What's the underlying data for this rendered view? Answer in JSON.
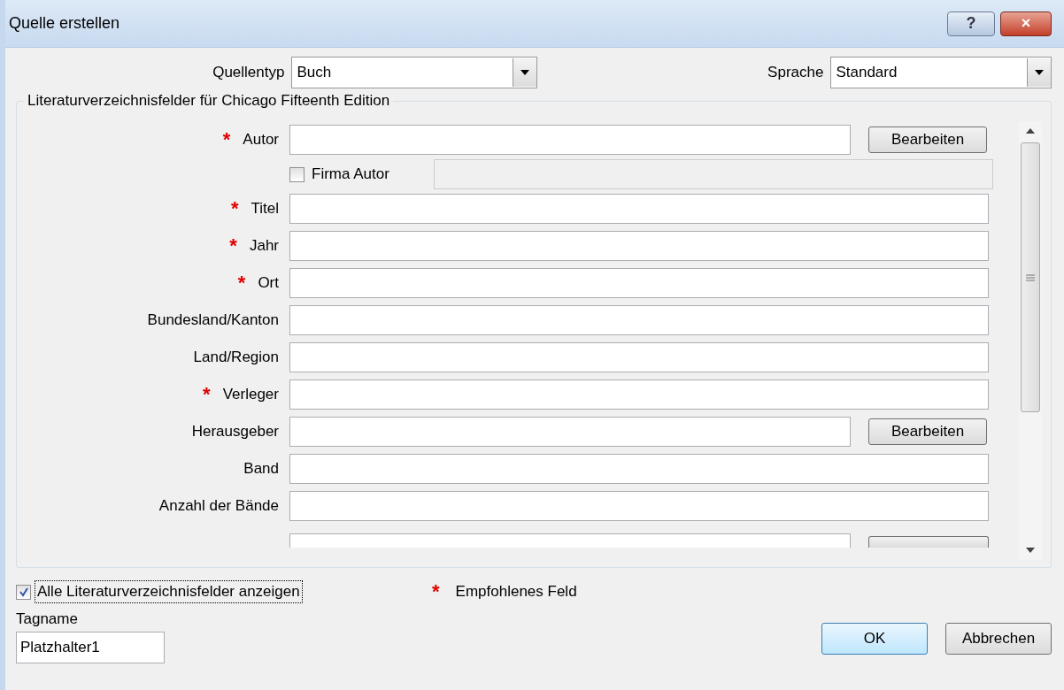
{
  "window": {
    "title": "Quelle erstellen",
    "help": "?",
    "close": "×"
  },
  "source_type": {
    "label": "Quellentyp",
    "value": "Buch"
  },
  "language": {
    "label": "Sprache",
    "value": "Standard"
  },
  "group": {
    "title": "Literaturverzeichnisfelder für Chicago Fifteenth Edition",
    "rows": [
      {
        "kind": "field",
        "label": "Autor",
        "required": true,
        "button": "Bearbeiten"
      },
      {
        "kind": "checkbox",
        "label": "Firma Autor",
        "checked": false
      },
      {
        "kind": "field",
        "label": "Titel",
        "required": true
      },
      {
        "kind": "field",
        "label": "Jahr",
        "required": true
      },
      {
        "kind": "field",
        "label": "Ort",
        "required": true
      },
      {
        "kind": "field",
        "label": "Bundesland/Kanton",
        "required": false
      },
      {
        "kind": "field",
        "label": "Land/Region",
        "required": false
      },
      {
        "kind": "field",
        "label": "Verleger",
        "required": true
      },
      {
        "kind": "field",
        "label": "Herausgeber",
        "required": false,
        "button": "Bearbeiten"
      },
      {
        "kind": "field",
        "label": "Band",
        "required": false
      },
      {
        "kind": "field",
        "label": "Anzahl der Bände",
        "required": false
      },
      {
        "kind": "cutoff",
        "button": true
      }
    ]
  },
  "show_all": {
    "label": "Alle Literaturverzeichnisfelder anzeigen",
    "checked": true
  },
  "legend": {
    "mark": "*",
    "label": "Empfohlenes Feld"
  },
  "tag": {
    "label": "Tagname",
    "value": "Platzhalter1"
  },
  "buttons": [
    {
      "label": "OK",
      "default": true
    },
    {
      "label": "Abbrechen",
      "default": false
    }
  ]
}
